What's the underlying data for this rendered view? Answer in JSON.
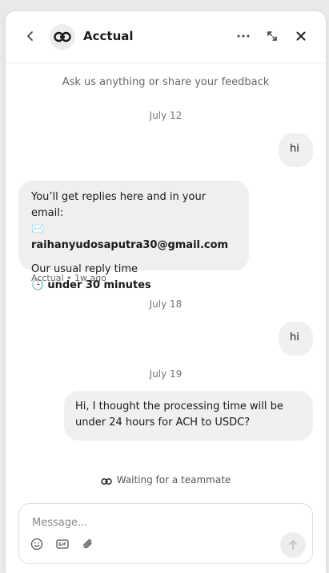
{
  "header": {
    "title": "Acctual",
    "icons": {
      "back": "chevron-left-icon",
      "logo": "link-icon",
      "more": "more-horizontal-icon",
      "expand": "expand-icon",
      "close": "close-icon"
    }
  },
  "conversation": {
    "intro": "Ask us anything or share your feedback",
    "dates": [
      "July 12",
      "July 18",
      "July 19"
    ],
    "messages": [
      {
        "from": "user",
        "text": "hi"
      },
      {
        "from": "user",
        "text": "hi"
      },
      {
        "from": "user",
        "text": "Hi, I thought the processing time will be under 24 hours for ACH to USDC?"
      }
    ],
    "bot": {
      "line1": "You’ll get replies here and in your email:",
      "email_emoji": "✉️",
      "email": "raihanyudosaputra30@gmail.com",
      "reply_time_label": "Our usual reply time",
      "clock_emoji": "🕒",
      "reply_time": "under 30 minutes",
      "meta": "Acctual • 1w ago"
    },
    "waiting": "Waiting for a teammate"
  },
  "composer": {
    "placeholder": "Message...",
    "icons": [
      "emoji-icon",
      "gif-icon",
      "attachment-icon",
      "send-icon"
    ]
  }
}
